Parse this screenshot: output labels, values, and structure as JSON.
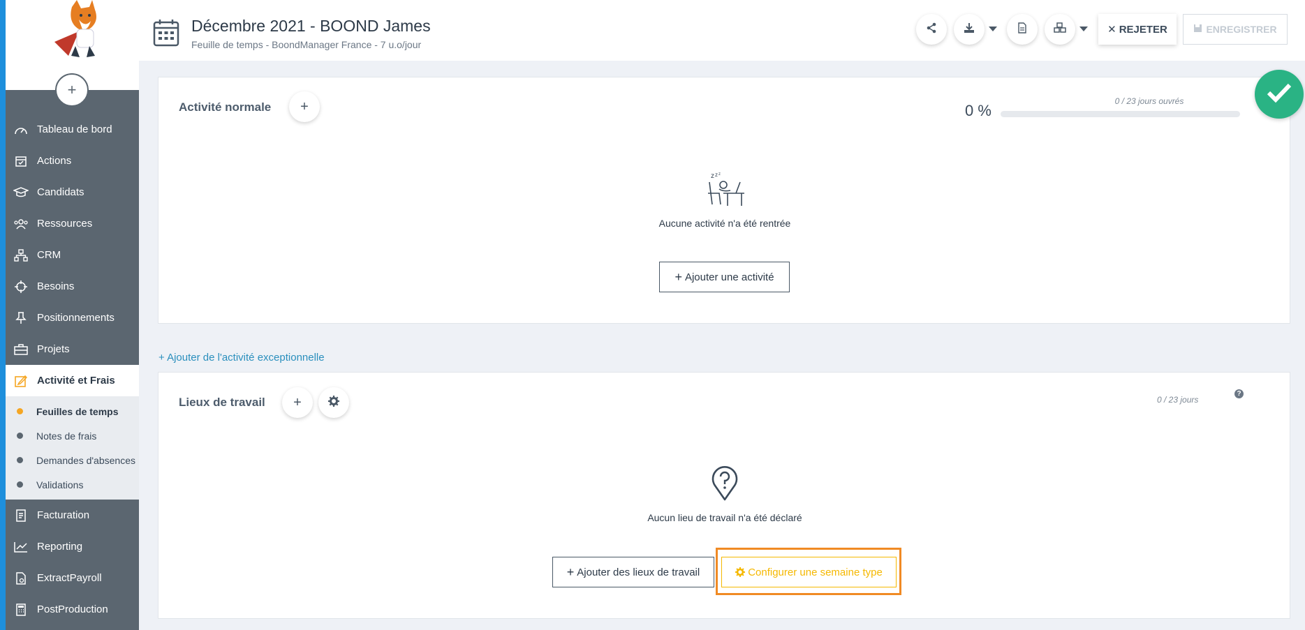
{
  "header": {
    "title": "Décembre 2021 - BOOND James",
    "subtitle": "Feuille de temps - BoondManager France - 7 u.o/jour",
    "reject_label": "REJETER",
    "save_label": "ENREGISTRER"
  },
  "sidebar": {
    "add_label": "+",
    "items": [
      {
        "label": "Tableau de bord",
        "icon": "dashboard-icon"
      },
      {
        "label": "Actions",
        "icon": "calendar-check-icon"
      },
      {
        "label": "Candidats",
        "icon": "graduation-cap-icon"
      },
      {
        "label": "Ressources",
        "icon": "users-icon"
      },
      {
        "label": "CRM",
        "icon": "sitemap-icon"
      },
      {
        "label": "Besoins",
        "icon": "crosshair-icon"
      },
      {
        "label": "Positionnements",
        "icon": "pin-icon"
      },
      {
        "label": "Projets",
        "icon": "briefcase-icon"
      },
      {
        "label": "Activité et Frais",
        "icon": "edit-icon"
      }
    ],
    "subitems": [
      {
        "label": "Feuilles de temps"
      },
      {
        "label": "Notes de frais"
      },
      {
        "label": "Demandes d'absences"
      },
      {
        "label": "Validations"
      }
    ],
    "items_after": [
      {
        "label": "Facturation",
        "icon": "invoice-icon"
      },
      {
        "label": "Reporting",
        "icon": "chart-line-icon"
      },
      {
        "label": "ExtractPayroll",
        "icon": "document-icon"
      },
      {
        "label": "PostProduction",
        "icon": "calculator-icon"
      }
    ]
  },
  "activity": {
    "title": "Activité normale",
    "percent": "0 %",
    "days": "0 / 23 jours ouvrés",
    "progress": 0,
    "empty_text": "Aucune activité n'a été rentrée",
    "add_button": "Ajouter une activité"
  },
  "exceptional_link": "+ Ajouter de l'activité exceptionnelle",
  "workplaces": {
    "title": "Lieux de travail",
    "days": "0 / 23 jours",
    "help": "?",
    "empty_text": "Aucun lieu de travail n'a été déclaré",
    "add_button": "Ajouter des lieux de travail",
    "config_button": "Configurer une semaine type"
  },
  "colors": {
    "sidebar": "#5b6670",
    "accent": "#f5a623",
    "success": "#2ab384",
    "link": "#2a8fbd",
    "highlight": "#f08a24"
  }
}
